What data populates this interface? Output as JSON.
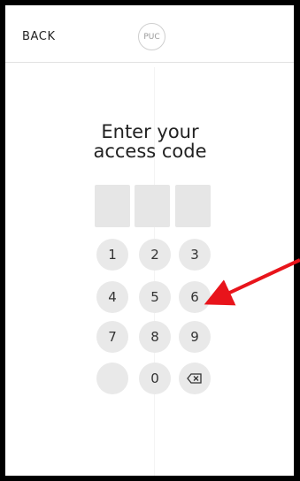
{
  "header": {
    "back_label": "BACK",
    "logo_text": "PUC"
  },
  "title": {
    "line1": "Enter your",
    "line2": "access code"
  },
  "keypad": {
    "keys": [
      "1",
      "2",
      "3",
      "4",
      "5",
      "6",
      "7",
      "8",
      "9",
      "",
      "0",
      "⌫"
    ],
    "backspace_icon": "backspace-icon"
  },
  "annotation": {
    "arrow_color": "#e8141b"
  }
}
